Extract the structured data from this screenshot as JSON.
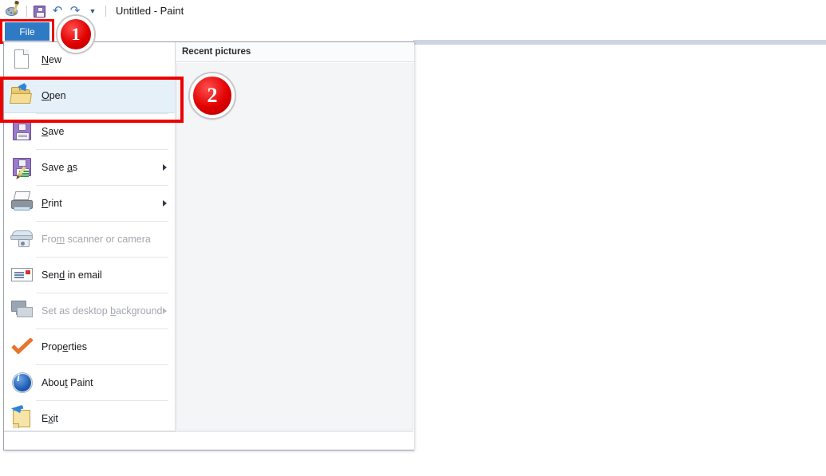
{
  "window": {
    "title": "Untitled - Paint",
    "quick_access": [
      {
        "name": "paint-app-icon",
        "label": "Paint"
      },
      {
        "name": "save-icon",
        "label": "Save"
      },
      {
        "name": "undo-icon",
        "label": "Undo",
        "glyph": "↶"
      },
      {
        "name": "redo-icon",
        "label": "Redo",
        "glyph": "↷"
      },
      {
        "name": "customize-quick-access-chevron-icon",
        "label": "Customize Quick Access Toolbar",
        "glyph": "▼"
      }
    ]
  },
  "ribbon": {
    "file_tab_label": "File"
  },
  "backstage": {
    "recent_header": "Recent pictures",
    "menu": [
      {
        "label": "New",
        "accel": "N",
        "icon": "new-page-icon",
        "disabled": false,
        "submenu": false,
        "highlighted": false
      },
      {
        "label": "Open",
        "accel": "O",
        "icon": "open-folder-icon",
        "disabled": false,
        "submenu": false,
        "highlighted": true
      },
      {
        "label": "Save",
        "accel": "S",
        "icon": "save-floppy-icon",
        "disabled": false,
        "submenu": false,
        "highlighted": false
      },
      {
        "label": "Save as",
        "accel": "a",
        "icon": "save-as-icon",
        "disabled": false,
        "submenu": true,
        "highlighted": false
      },
      {
        "label": "Print",
        "accel": "P",
        "icon": "printer-icon",
        "disabled": false,
        "submenu": true,
        "highlighted": false
      },
      {
        "label": "From scanner or camera",
        "accel": "m",
        "icon": "scanner-camera-icon",
        "disabled": true,
        "submenu": false,
        "highlighted": false
      },
      {
        "label": "Send in email",
        "accel": "d",
        "icon": "envelope-icon",
        "disabled": false,
        "submenu": false,
        "highlighted": false
      },
      {
        "label": "Set as desktop background",
        "accel": "b",
        "icon": "desktop-monitor-icon",
        "disabled": true,
        "submenu": true,
        "highlighted": false
      },
      {
        "label": "Properties",
        "accel": "e",
        "icon": "orange-checkmark-icon",
        "disabled": false,
        "submenu": false,
        "highlighted": false
      },
      {
        "label": "About Paint",
        "accel": "t",
        "icon": "info-circle-icon",
        "disabled": false,
        "submenu": false,
        "highlighted": false
      },
      {
        "label": "Exit",
        "accel": "x",
        "icon": "exit-folder-icon",
        "disabled": false,
        "submenu": false,
        "highlighted": false
      }
    ]
  },
  "annotations": {
    "step1": "1",
    "step2": "2",
    "highlight_color": "#ef0000",
    "badge_color": "#e00000"
  }
}
